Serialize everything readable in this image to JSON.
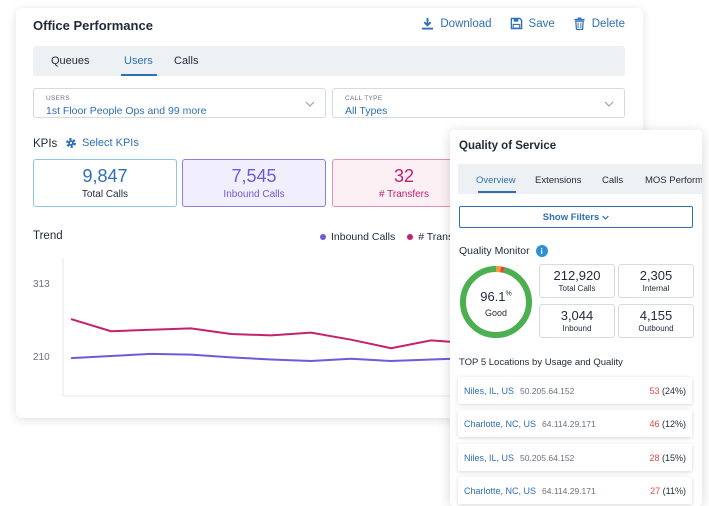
{
  "office": {
    "title": "Office Performance",
    "actions": {
      "download": "Download",
      "save": "Save",
      "delete": "Delete"
    },
    "tabs": [
      {
        "label": "Queues"
      },
      {
        "label": "Users"
      },
      {
        "label": "Calls"
      }
    ],
    "active_tab": "Users",
    "filters": {
      "users": {
        "label": "USERS",
        "value": "1st Floor People Ops and 99 more"
      },
      "call_type": {
        "label": "CALL TYPE",
        "value": "All Types"
      }
    },
    "kpis": {
      "label": "KPIs",
      "select_label": "Select KPIs",
      "cards": [
        {
          "value": "9,847",
          "label": "Total Calls"
        },
        {
          "value": "7,545",
          "label": "Inbound Calls"
        },
        {
          "value": "32",
          "label": "# Transfers"
        }
      ]
    },
    "trend": {
      "title": "Trend",
      "legend": [
        "Inbound Calls",
        "# Transf"
      ],
      "colors": {
        "inbound": "#6f5bd8",
        "transfers": "#c4216f"
      }
    }
  },
  "chart_data": {
    "type": "line",
    "y_ticks": [
      313,
      210
    ],
    "series": [
      {
        "name": "Inbound Calls",
        "values": [
          207,
          210,
          213,
          212,
          208,
          205,
          203,
          206,
          203,
          205,
          207
        ]
      },
      {
        "name": "# Transfers",
        "values": [
          262,
          245,
          247,
          249,
          241,
          239,
          243,
          233,
          221,
          232,
          228,
          225
        ]
      }
    ]
  },
  "qos": {
    "title": "Quality of Service",
    "tabs": [
      {
        "label": "Overview"
      },
      {
        "label": "Extensions"
      },
      {
        "label": "Calls"
      },
      {
        "label": "MOS Performa"
      }
    ],
    "show_filters": "Show Filters",
    "quality_monitor": {
      "title": "Quality Monitor",
      "gauge": {
        "value": "96.1",
        "unit": "%",
        "status": "Good",
        "percent": 96.1,
        "colors": {
          "good": "#4caf50",
          "warn": "#f39c34",
          "bad": "#e0474c"
        }
      },
      "stats": [
        {
          "value": "212,920",
          "label": "Total Calls"
        },
        {
          "value": "2,305",
          "label": "Internal"
        },
        {
          "value": "3,044",
          "label": "Inbound"
        },
        {
          "value": "4,155",
          "label": "Outbound"
        }
      ]
    },
    "top5_title": "TOP 5 Locations by Usage and Quality",
    "locations": [
      {
        "name": "Niles, IL, US",
        "ip": "50.205.64.152",
        "count": "53",
        "pct": "(24%)"
      },
      {
        "name": "Charlotte, NC, US",
        "ip": "64.114.29.171",
        "count": "46",
        "pct": "(12%)"
      },
      {
        "name": "Niles, IL, US",
        "ip": "50.205.64.152",
        "count": "28",
        "pct": "(15%)"
      },
      {
        "name": "Charlotte, NC, US",
        "ip": "64.114.29.171",
        "count": "27",
        "pct": "(11%)"
      }
    ]
  }
}
